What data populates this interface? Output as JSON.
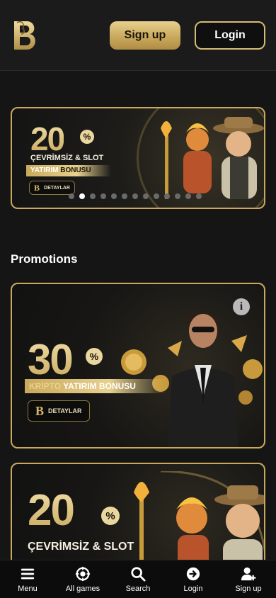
{
  "header": {
    "signup_label": "Sign up",
    "login_label": "Login"
  },
  "hero": {
    "percent": "20",
    "pct_symbol": "%",
    "line1": "ÇEVRİMSİZ & SLOT",
    "ribbon_a": "YATIRIM",
    "ribbon_b": "BONUSU",
    "details_label": "DETAYLAR",
    "slide_count": 13,
    "active_slide": 2
  },
  "promotions": {
    "title": "Promotions",
    "cards": [
      {
        "percent": "30",
        "pct_symbol": "%",
        "ribbon_a": "KRİPTO",
        "ribbon_b": "YATIRIM BONUSU",
        "details_label": "DETAYLAR",
        "info": "i"
      },
      {
        "percent": "20",
        "pct_symbol": "%",
        "line1": "ÇEVRİMSİZ & SLOT"
      }
    ]
  },
  "bottom_nav": [
    {
      "label": "Menu",
      "icon": "menu-icon"
    },
    {
      "label": "All games",
      "icon": "chip-icon"
    },
    {
      "label": "Search",
      "icon": "search-icon"
    },
    {
      "label": "Login",
      "icon": "login-icon"
    },
    {
      "label": "Sign up",
      "icon": "add-user-icon"
    }
  ],
  "colors": {
    "gold": "#c9a95c",
    "gold_light": "#e8d08e",
    "background": "#151515"
  }
}
